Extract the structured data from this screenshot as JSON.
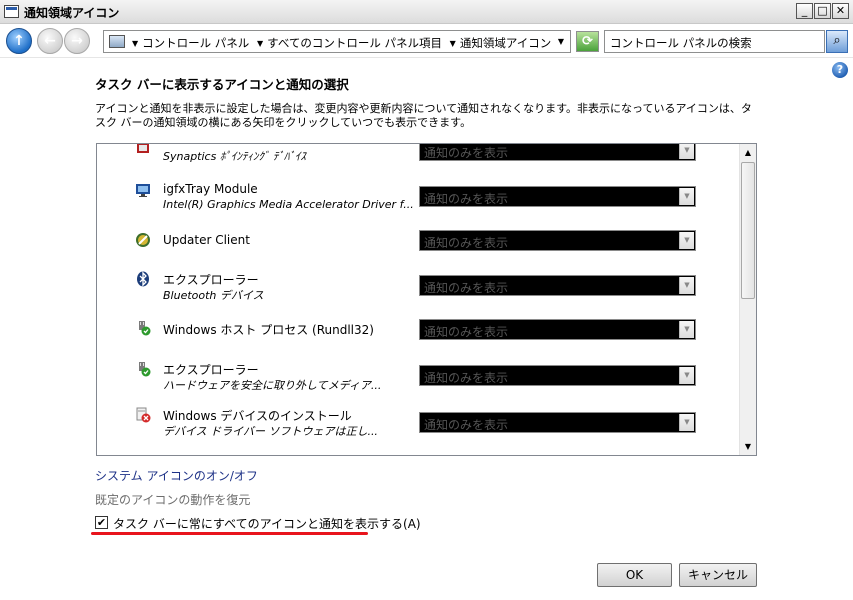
{
  "window": {
    "title": "通知領域アイコン"
  },
  "addressbar": {
    "breadcrumbs": [
      "コントロール パネル",
      "すべてのコントロール パネル項目",
      "通知領域アイコン"
    ],
    "search_placeholder": "コントロール パネルの検索"
  },
  "page": {
    "heading": "タスク バーに表示するアイコンと通知の選択",
    "description": "アイコンと通知を非表示に設定した場合は、変更内容や更新内容について通知されなくなります。非表示になっているアイコンは、タスク バーの通知領域の横にある矢印をクリックしていつでも表示できます。"
  },
  "items": [
    {
      "name": "",
      "sub": "Synaptics ﾎﾟｲﾝﾃｨﾝｸﾞ ﾃﾞﾊﾞｲｽ",
      "behavior": "通知のみを表示",
      "icon": "synaptics-icon"
    },
    {
      "name": "igfxTray Module",
      "sub": "Intel(R) Graphics Media Accelerator Driver f...",
      "behavior": "通知のみを表示",
      "icon": "monitor-icon"
    },
    {
      "name": "Updater Client",
      "sub": "",
      "behavior": "通知のみを表示",
      "icon": "updater-icon"
    },
    {
      "name": "エクスプローラー",
      "sub": "Bluetooth デバイス",
      "behavior": "通知のみを表示",
      "icon": "bluetooth-icon"
    },
    {
      "name": "Windows ホスト プロセス (Rundll32)",
      "sub": "",
      "behavior": "通知のみを表示",
      "icon": "usb-plug-icon"
    },
    {
      "name": "エクスプローラー",
      "sub": "ハードウェアを安全に取り外してメディア...",
      "behavior": "通知のみを表示",
      "icon": "safely-remove-icon"
    },
    {
      "name": "Windows デバイスのインストール",
      "sub": "デバイス ドライバー ソフトウェアは正し...",
      "behavior": "通知のみを表示",
      "icon": "device-install-icon"
    }
  ],
  "links": {
    "system_icons": "システム アイコンのオン/オフ",
    "restore_default": "既定のアイコンの動作を復元"
  },
  "checkbox": {
    "label": "タスク バーに常にすべてのアイコンと通知を表示する(A)",
    "checked": true
  },
  "buttons": {
    "ok": "OK",
    "cancel": "キャンセル"
  },
  "colors": {
    "highlight_underline": "#e8141c",
    "link": "#1e3287"
  }
}
